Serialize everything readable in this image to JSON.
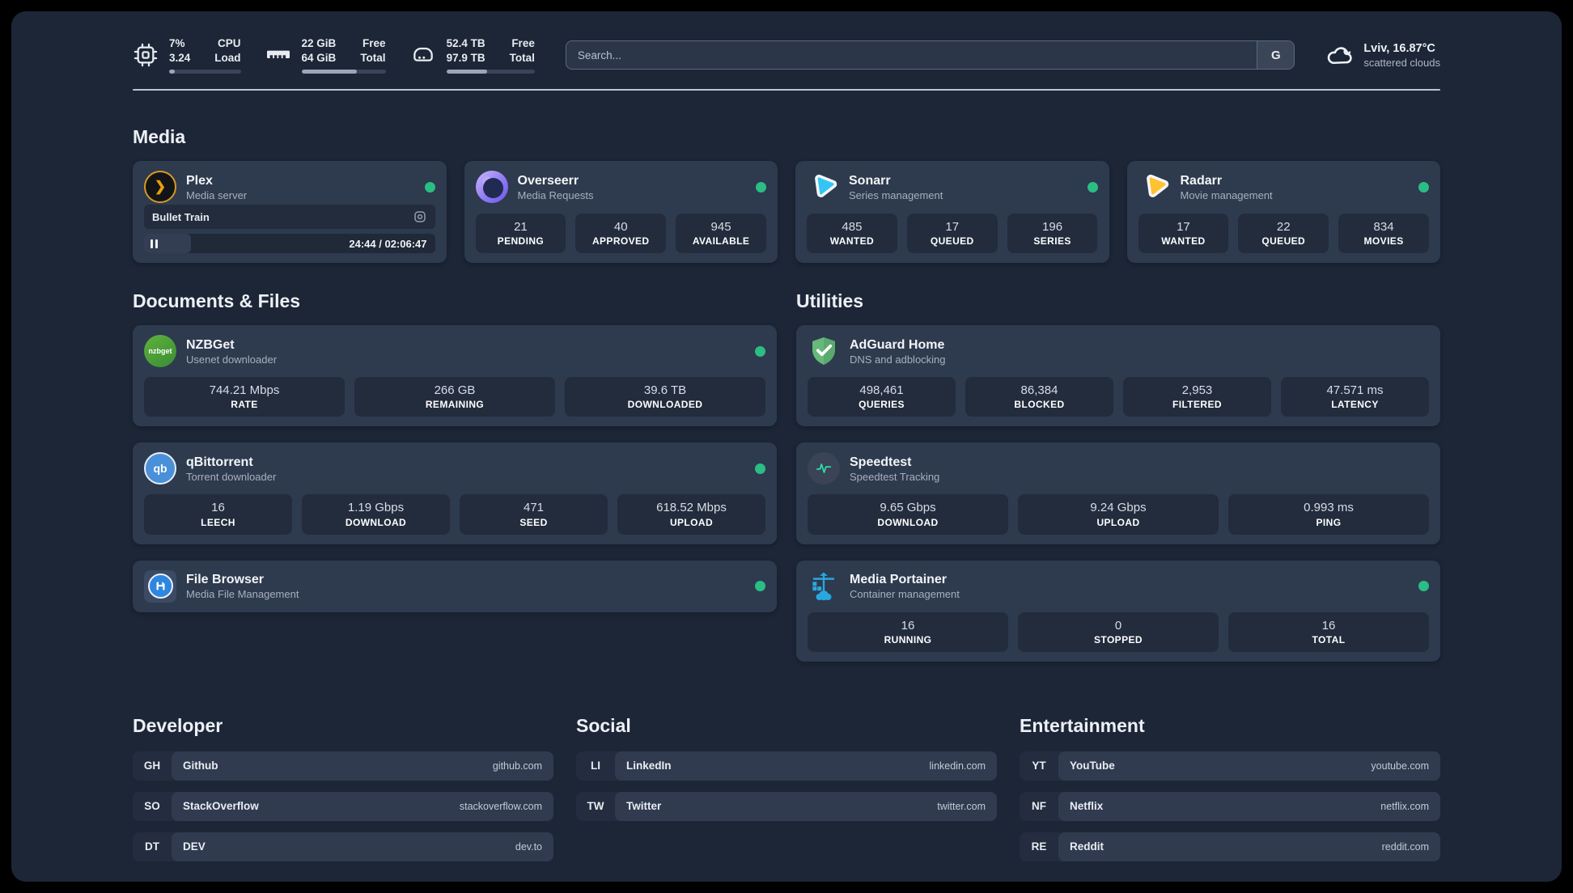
{
  "colors": {
    "status_online": "#2abd84",
    "plex_amber": "#e5a00d",
    "sonarr_cyan": "#35c5f4",
    "radarr_yellow": "#ffc230",
    "nzbget_green": "#4ca43a",
    "qbittorrent_blue": "#4a90d9",
    "adguard_green": "#67b87b",
    "portainer_blue": "#29a8df",
    "speedtest_pulse": "#2fe6a8"
  },
  "header": {
    "hardware": [
      {
        "icon": "cpu-icon",
        "value_top": "7%",
        "value_bottom": "3.24",
        "label_top": "CPU",
        "label_bottom": "Load",
        "bar_style": "width:8%"
      },
      {
        "icon": "ram-icon",
        "value_top": "22 GiB",
        "value_bottom": "64 GiB",
        "label_top": "Free",
        "label_bottom": "Total",
        "bar_style": "width:66%"
      },
      {
        "icon": "disk-icon",
        "value_top": "52.4 TB",
        "value_bottom": "97.9 TB",
        "label_top": "Free",
        "label_bottom": "Total",
        "bar_style": "width:46%"
      }
    ],
    "search": {
      "placeholder": "Search...",
      "engine_button": "G"
    },
    "weather": {
      "icon": "cloud-icon",
      "location": "Lviv, 16.87°C",
      "condition": "scattered clouds"
    }
  },
  "media": {
    "heading": "Media",
    "cards": [
      {
        "icon": "plex-icon",
        "name": "Plex",
        "desc": "Media server",
        "status": "online",
        "now_playing": {
          "title": "Bullet Train",
          "time": "24:44 / 02:06:47"
        }
      },
      {
        "icon": "overseerr-icon",
        "name": "Overseerr",
        "desc": "Media Requests",
        "status": "online",
        "stats": [
          {
            "value": "21",
            "label": "PENDING"
          },
          {
            "value": "40",
            "label": "APPROVED"
          },
          {
            "value": "945",
            "label": "AVAILABLE"
          }
        ]
      },
      {
        "icon": "sonarr-icon",
        "name": "Sonarr",
        "desc": "Series management",
        "status": "online",
        "stats": [
          {
            "value": "485",
            "label": "WANTED"
          },
          {
            "value": "17",
            "label": "QUEUED"
          },
          {
            "value": "196",
            "label": "SERIES"
          }
        ]
      },
      {
        "icon": "radarr-icon",
        "name": "Radarr",
        "desc": "Movie management",
        "status": "online",
        "stats": [
          {
            "value": "17",
            "label": "WANTED"
          },
          {
            "value": "22",
            "label": "QUEUED"
          },
          {
            "value": "834",
            "label": "MOVIES"
          }
        ]
      }
    ]
  },
  "documents": {
    "heading": "Documents & Files",
    "cards": [
      {
        "icon": "nzbget-icon",
        "icon_text": "nzbget",
        "name": "NZBGet",
        "desc": "Usenet downloader",
        "status": "online",
        "stats": [
          {
            "value": "744.21 Mbps",
            "label": "RATE"
          },
          {
            "value": "266 GB",
            "label": "REMAINING"
          },
          {
            "value": "39.6 TB",
            "label": "DOWNLOADED"
          }
        ]
      },
      {
        "icon": "qbittorrent-icon",
        "icon_text": "qb",
        "name": "qBittorrent",
        "desc": "Torrent downloader",
        "status": "online",
        "stats": [
          {
            "value": "16",
            "label": "LEECH"
          },
          {
            "value": "1.19 Gbps",
            "label": "DOWNLOAD"
          },
          {
            "value": "471",
            "label": "SEED"
          },
          {
            "value": "618.52 Mbps",
            "label": "UPLOAD"
          }
        ]
      },
      {
        "icon": "filebrowser-icon",
        "name": "File Browser",
        "desc": "Media File Management",
        "status": "online"
      }
    ]
  },
  "utilities": {
    "heading": "Utilities",
    "cards": [
      {
        "icon": "adguard-icon",
        "name": "AdGuard Home",
        "desc": "DNS and adblocking",
        "stats": [
          {
            "value": "498,461",
            "label": "QUERIES"
          },
          {
            "value": "86,384",
            "label": "BLOCKED"
          },
          {
            "value": "2,953",
            "label": "FILTERED"
          },
          {
            "value": "47.571 ms",
            "label": "LATENCY"
          }
        ]
      },
      {
        "icon": "speedtest-icon",
        "name": "Speedtest",
        "desc": "Speedtest Tracking",
        "stats": [
          {
            "value": "9.65 Gbps",
            "label": "DOWNLOAD"
          },
          {
            "value": "9.24 Gbps",
            "label": "UPLOAD"
          },
          {
            "value": "0.993 ms",
            "label": "PING"
          }
        ]
      },
      {
        "icon": "portainer-icon",
        "name": "Media Portainer",
        "desc": "Container management",
        "status": "online",
        "stats": [
          {
            "value": "16",
            "label": "RUNNING"
          },
          {
            "value": "0",
            "label": "STOPPED"
          },
          {
            "value": "16",
            "label": "TOTAL"
          }
        ]
      }
    ]
  },
  "links": [
    {
      "heading": "Developer",
      "items": [
        {
          "abbr": "GH",
          "name": "Github",
          "url": "github.com"
        },
        {
          "abbr": "SO",
          "name": "StackOverflow",
          "url": "stackoverflow.com"
        },
        {
          "abbr": "DT",
          "name": "DEV",
          "url": "dev.to"
        }
      ]
    },
    {
      "heading": "Social",
      "items": [
        {
          "abbr": "LI",
          "name": "LinkedIn",
          "url": "linkedin.com"
        },
        {
          "abbr": "TW",
          "name": "Twitter",
          "url": "twitter.com"
        }
      ]
    },
    {
      "heading": "Entertainment",
      "items": [
        {
          "abbr": "YT",
          "name": "YouTube",
          "url": "youtube.com"
        },
        {
          "abbr": "NF",
          "name": "Netflix",
          "url": "netflix.com"
        },
        {
          "abbr": "RE",
          "name": "Reddit",
          "url": "reddit.com"
        }
      ]
    }
  ]
}
